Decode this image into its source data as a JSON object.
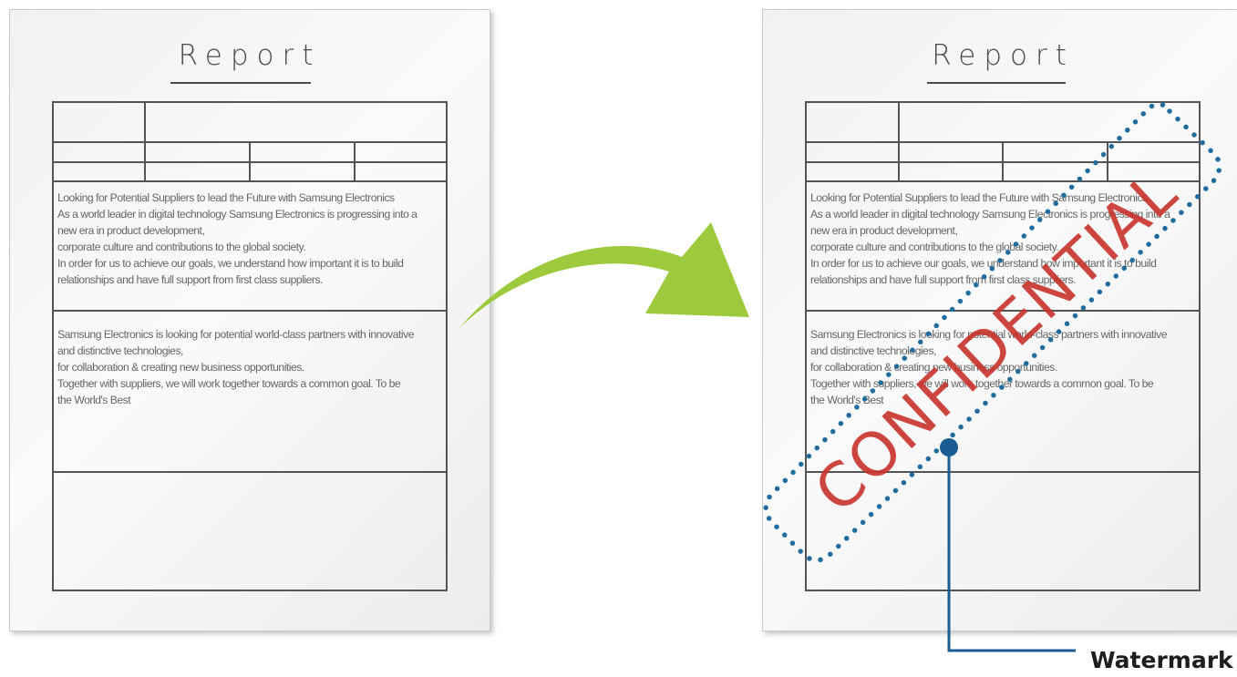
{
  "documents": {
    "before": {
      "title": "Report",
      "paragraph1": [
        "Looking for Potential Suppliers to lead the Future with Samsung Electronics",
        "As a world leader in digital technology Samsung Electronics is progressing into a",
        "new era in product development,",
        "corporate culture and contributions to the global society.",
        "In order for us to achieve our goals, we understand how important it is to build",
        "relationships and have full support from first class suppliers."
      ],
      "paragraph2": [
        "Samsung Electronics is looking for potential world-class partners with innovative",
        "and distinctive technologies,",
        "for collaboration & creating new business opportunities.",
        "Together with suppliers, we will work together towards a common goal. To be",
        "the World's Best"
      ]
    },
    "after": {
      "title": "Report",
      "paragraph1": [
        "Looking for Potential Suppliers to lead the Future with Samsung Electronics",
        "As a world leader in digital technology Samsung Electronics is progressing into a",
        "new era in product development,",
        "corporate culture and contributions to the global society.",
        "In order for us to achieve our goals, we understand how important it is to build",
        "relationships and have full support from first class suppliers."
      ],
      "paragraph2": [
        "Samsung Electronics is looking for potential world-class partners with innovative",
        "and distinctive technologies,",
        "for collaboration & creating new business opportunities.",
        "Together with suppliers, we will work together towards a common goal. To be",
        "the World's Best"
      ],
      "watermark_text": "CONFIDENTIAL"
    }
  },
  "callout": {
    "label": "Watermark"
  },
  "colors": {
    "arrow": "#9cca3c",
    "watermark_text": "#c8322a",
    "dotted_outline": "#1f6d9e",
    "callout_line": "#1a5d94",
    "table_lines": "#545454"
  }
}
